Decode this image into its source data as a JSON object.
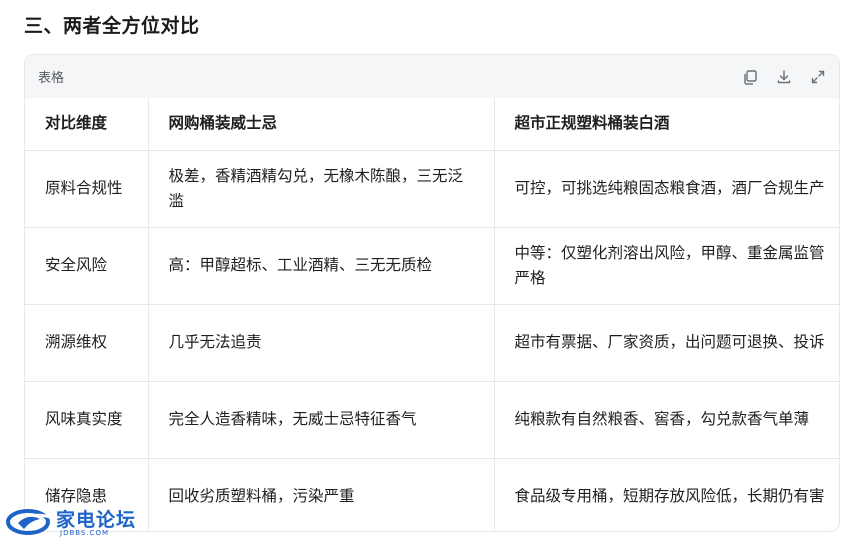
{
  "section": {
    "title": "三、两者全方位对比"
  },
  "table_card": {
    "label": "表格",
    "actions": [
      {
        "name": "copy",
        "icon": "copy-icon"
      },
      {
        "name": "download",
        "icon": "download-icon"
      },
      {
        "name": "expand",
        "icon": "expand-icon"
      }
    ]
  },
  "table": {
    "headers": [
      "对比维度",
      "网购桶装威士忌",
      "超市正规塑料桶装白酒"
    ],
    "rows": [
      [
        "原料合规性",
        "极差，香精酒精勾兑，无橡木陈酿，三无泛滥",
        "可控，可挑选纯粮固态粮食酒，酒厂合规生产"
      ],
      [
        "安全风险",
        "高：甲醇超标、工业酒精、三无无质检",
        "中等：仅塑化剂溶出风险，甲醇、重金属监管严格"
      ],
      [
        "溯源维权",
        "几乎无法追责",
        "超市有票据、厂家资质，出问题可退换、投诉"
      ],
      [
        "风味真实度",
        "完全人造香精味，无威士忌特征香气",
        "纯粮款有自然粮香、窖香，勾兑款香气单薄"
      ],
      [
        "储存隐患",
        "回收劣质塑料桶，污染严重",
        "食品级专用桶，短期存放风险低，长期仍有害"
      ]
    ]
  },
  "watermark": {
    "name": "家电论坛",
    "domain": "JDBBS.COM",
    "brand_color": "#1e63c8"
  },
  "colors": {
    "border": "#e6e8eb",
    "header_bg": "#f5f6f7",
    "text": "#1f1f1f",
    "muted": "#555a60"
  }
}
